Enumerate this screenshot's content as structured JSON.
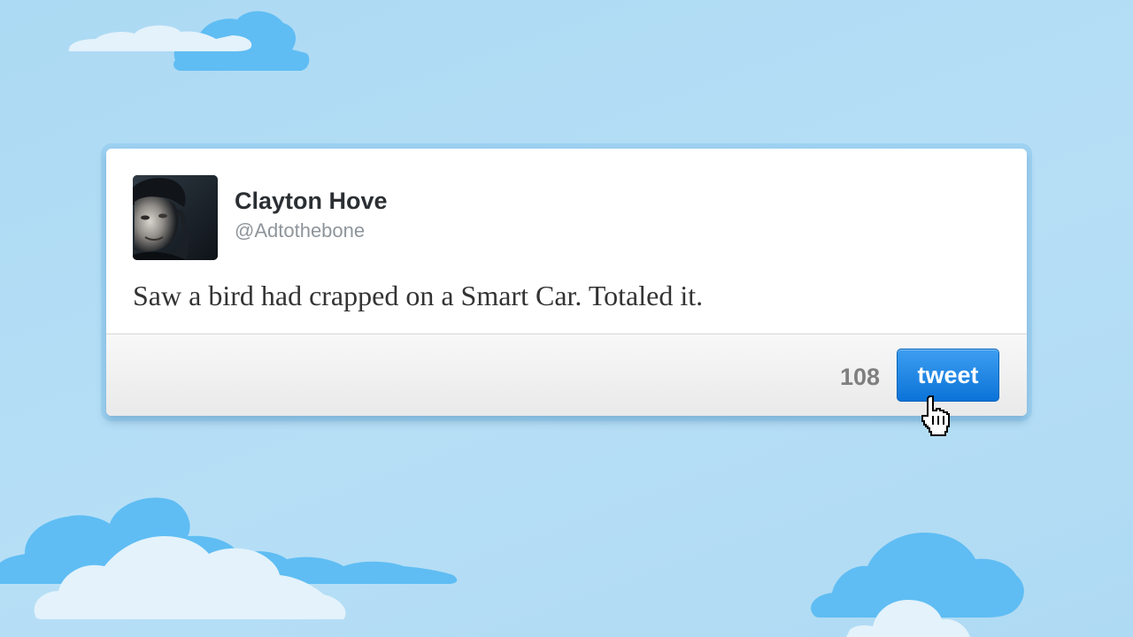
{
  "tweet": {
    "author": {
      "name": "Clayton Hove",
      "handle": "@Adtothebone"
    },
    "text": "Saw a bird had crapped on a Smart Car. Totaled it.",
    "remaining_chars": "108",
    "submit_label": "tweet"
  },
  "icons": {
    "avatar": "user-avatar-photo",
    "cursor": "hand-pointer-icon"
  },
  "colors": {
    "sky": "#acd9f3",
    "cloud_blue": "#5fbdf3",
    "cloud_white": "#e3f2fb",
    "button_blue": "#0b73d8"
  }
}
